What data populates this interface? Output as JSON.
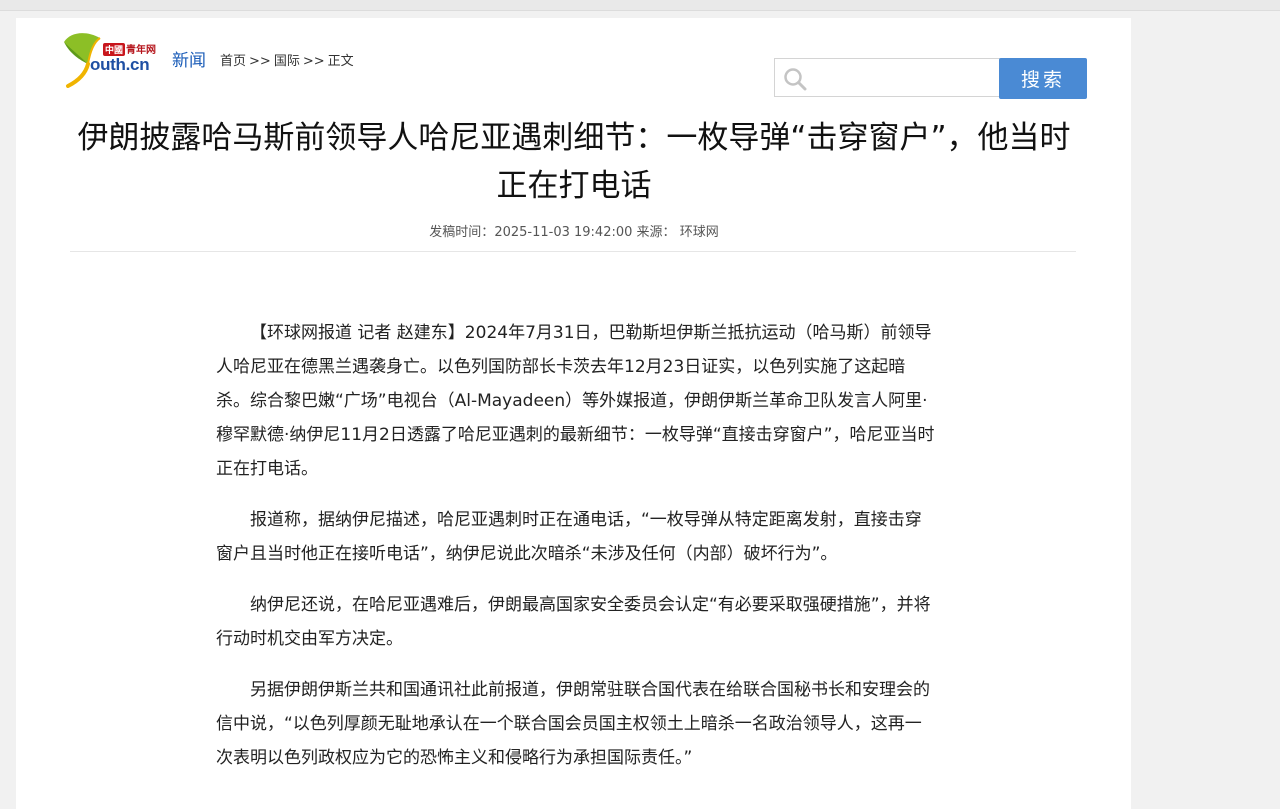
{
  "logo": {
    "badge_red": "中國",
    "badge_text": "青年网",
    "domain": "outh.cn",
    "domain_initial": "y"
  },
  "channel": "新闻",
  "breadcrumb": {
    "items": [
      "首页",
      "国际",
      "正文"
    ],
    "separator": ">>"
  },
  "search": {
    "placeholder": "",
    "button_label": "搜索"
  },
  "article": {
    "title": "伊朗披露哈马斯前领导人哈尼亚遇刺细节：一枚导弹“击穿窗户”，他当时正在打电话",
    "meta_time_label": "发稿时间：",
    "meta_time": "2025-11-03 19:42:00",
    "meta_source_label": "来源：",
    "meta_source": "环球网",
    "paragraphs": [
      "【环球网报道 记者 赵建东】2024年7月31日，巴勒斯坦伊斯兰抵抗运动（哈马斯）前领导人哈尼亚在德黑兰遇袭身亡。以色列国防部长卡茨去年12月23日证实，以色列实施了这起暗杀。综合黎巴嫩“广场”电视台（Al-Mayadeen）等外媒报道，伊朗伊斯兰革命卫队发言人阿里·穆罕默德·纳伊尼11月2日透露了哈尼亚遇刺的最新细节：一枚导弹“直接击穿窗户”，哈尼亚当时正在打电话。",
      "报道称，据纳伊尼描述，哈尼亚遇刺时正在通电话，“一枚导弹从特定距离发射，直接击穿窗户且当时他正在接听电话”，纳伊尼说此次暗杀“未涉及任何（内部）破坏行为”。",
      "纳伊尼还说，在哈尼亚遇难后，伊朗最高国家安全委员会认定“有必要采取强硬措施”，并将行动时机交由军方决定。",
      "另据伊朗伊斯兰共和国通讯社此前报道，伊朗常驻联合国代表在给联合国秘书长和安理会的信中说，“以色列厚颜无耻地承认在一个联合国会员国主权领土上暗杀一名政治领导人，这再一次表明以色列政权应为它的恐怖主义和侵略行为承担国际责任。”"
    ]
  },
  "colors": {
    "brand_blue": "#1f4fa3",
    "button_blue": "#4a8ad4",
    "logo_green": "#8cbf26",
    "logo_yellow": "#f0b400",
    "badge_red": "#c8161d"
  }
}
